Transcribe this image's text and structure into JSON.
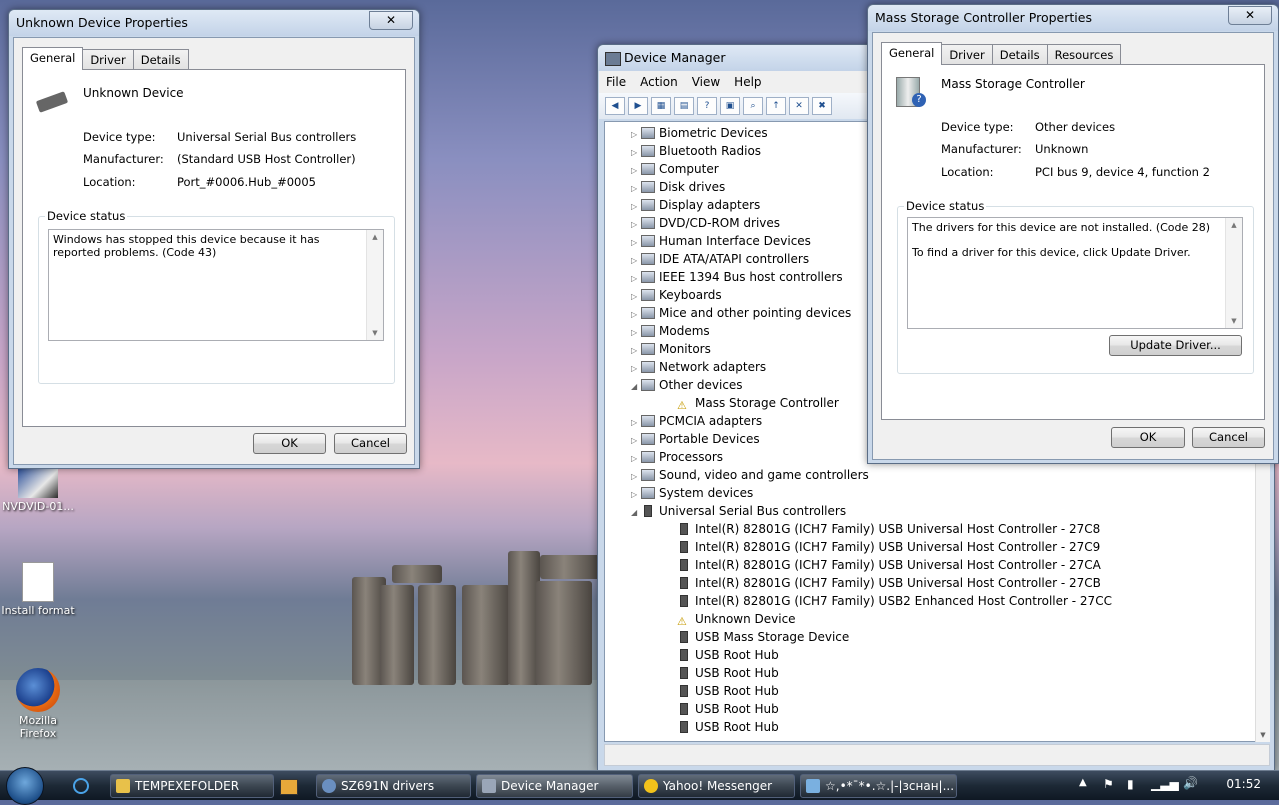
{
  "desktop": {
    "icons": [
      {
        "label": "NVDVID-01..."
      },
      {
        "label": "Install format"
      },
      {
        "label": "Mozilla Firefox"
      }
    ]
  },
  "unknown_props": {
    "title": "Unknown Device Properties",
    "close": "✕",
    "tabs": [
      "General",
      "Driver",
      "Details"
    ],
    "device_name": "Unknown Device",
    "device_type_label": "Device type:",
    "device_type": "Universal Serial Bus controllers",
    "manufacturer_label": "Manufacturer:",
    "manufacturer": "(Standard USB Host Controller)",
    "location_label": "Location:",
    "location": "Port_#0006.Hub_#0005",
    "status_group": "Device status",
    "status_text": "Windows has stopped this device because it has reported problems. (Code 43)",
    "ok": "OK",
    "cancel": "Cancel"
  },
  "device_manager": {
    "title": "Device Manager",
    "menus": [
      "File",
      "Action",
      "View",
      "Help"
    ],
    "tree": [
      {
        "label": "Biometric Devices",
        "level": 0,
        "expand": "▷",
        "icon": "category"
      },
      {
        "label": "Bluetooth Radios",
        "level": 0,
        "expand": "▷",
        "icon": "category"
      },
      {
        "label": "Computer",
        "level": 0,
        "expand": "▷",
        "icon": "category"
      },
      {
        "label": "Disk drives",
        "level": 0,
        "expand": "▷",
        "icon": "category"
      },
      {
        "label": "Display adapters",
        "level": 0,
        "expand": "▷",
        "icon": "category"
      },
      {
        "label": "DVD/CD-ROM drives",
        "level": 0,
        "expand": "▷",
        "icon": "category"
      },
      {
        "label": "Human Interface Devices",
        "level": 0,
        "expand": "▷",
        "icon": "category"
      },
      {
        "label": "IDE ATA/ATAPI controllers",
        "level": 0,
        "expand": "▷",
        "icon": "category"
      },
      {
        "label": "IEEE 1394 Bus host controllers",
        "level": 0,
        "expand": "▷",
        "icon": "category"
      },
      {
        "label": "Keyboards",
        "level": 0,
        "expand": "▷",
        "icon": "category"
      },
      {
        "label": "Mice and other pointing devices",
        "level": 0,
        "expand": "▷",
        "icon": "category"
      },
      {
        "label": "Modems",
        "level": 0,
        "expand": "▷",
        "icon": "category"
      },
      {
        "label": "Monitors",
        "level": 0,
        "expand": "▷",
        "icon": "category"
      },
      {
        "label": "Network adapters",
        "level": 0,
        "expand": "▷",
        "icon": "category"
      },
      {
        "label": "Other devices",
        "level": 0,
        "expand": "◢",
        "icon": "category"
      },
      {
        "label": "Mass Storage Controller",
        "level": 1,
        "expand": "",
        "icon": "warn"
      },
      {
        "label": "PCMCIA adapters",
        "level": 0,
        "expand": "▷",
        "icon": "category"
      },
      {
        "label": "Portable Devices",
        "level": 0,
        "expand": "▷",
        "icon": "category"
      },
      {
        "label": "Processors",
        "level": 0,
        "expand": "▷",
        "icon": "category"
      },
      {
        "label": "Sound, video and game controllers",
        "level": 0,
        "expand": "▷",
        "icon": "category"
      },
      {
        "label": "System devices",
        "level": 0,
        "expand": "▷",
        "icon": "category"
      },
      {
        "label": "Universal Serial Bus controllers",
        "level": 0,
        "expand": "◢",
        "icon": "usb"
      },
      {
        "label": "Intel(R) 82801G (ICH7 Family) USB Universal Host Controller - 27C8",
        "level": 1,
        "expand": "",
        "icon": "usb"
      },
      {
        "label": "Intel(R) 82801G (ICH7 Family) USB Universal Host Controller - 27C9",
        "level": 1,
        "expand": "",
        "icon": "usb"
      },
      {
        "label": "Intel(R) 82801G (ICH7 Family) USB Universal Host Controller - 27CA",
        "level": 1,
        "expand": "",
        "icon": "usb"
      },
      {
        "label": "Intel(R) 82801G (ICH7 Family) USB Universal Host Controller - 27CB",
        "level": 1,
        "expand": "",
        "icon": "usb"
      },
      {
        "label": "Intel(R) 82801G (ICH7 Family) USB2 Enhanced Host Controller - 27CC",
        "level": 1,
        "expand": "",
        "icon": "usb"
      },
      {
        "label": "Unknown Device",
        "level": 1,
        "expand": "",
        "icon": "warn"
      },
      {
        "label": "USB Mass Storage Device",
        "level": 1,
        "expand": "",
        "icon": "usb"
      },
      {
        "label": "USB Root Hub",
        "level": 1,
        "expand": "",
        "icon": "usb"
      },
      {
        "label": "USB Root Hub",
        "level": 1,
        "expand": "",
        "icon": "usb"
      },
      {
        "label": "USB Root Hub",
        "level": 1,
        "expand": "",
        "icon": "usb"
      },
      {
        "label": "USB Root Hub",
        "level": 1,
        "expand": "",
        "icon": "usb"
      },
      {
        "label": "USB Root Hub",
        "level": 1,
        "expand": "",
        "icon": "usb"
      }
    ]
  },
  "mass_props": {
    "title": "Mass Storage Controller Properties",
    "close": "✕",
    "tabs": [
      "General",
      "Driver",
      "Details",
      "Resources"
    ],
    "device_name": "Mass Storage Controller",
    "device_type_label": "Device type:",
    "device_type": "Other devices",
    "manufacturer_label": "Manufacturer:",
    "manufacturer": "Unknown",
    "location_label": "Location:",
    "location": "PCI bus 9, device 4, function 2",
    "status_group": "Device status",
    "status_line1": "The drivers for this device are not installed. (Code 28)",
    "status_line2": "To find a driver for this device, click Update Driver.",
    "update_driver": "Update Driver...",
    "ok": "OK",
    "cancel": "Cancel"
  },
  "taskbar": {
    "items": [
      {
        "label": "TEMPEXEFOLDER",
        "color": "#e8c14a"
      },
      {
        "label": "SZ691N drivers",
        "color": "#6a8fc0"
      },
      {
        "label": "Device Manager",
        "color": "#9aa6b8"
      },
      {
        "label": "Yahoo! Messenger",
        "color": "#f2c21b"
      },
      {
        "label": "☆,•*¯*•.☆.|-|зснан|...",
        "color": "#7ab0e0"
      }
    ],
    "clock": "01:52"
  }
}
